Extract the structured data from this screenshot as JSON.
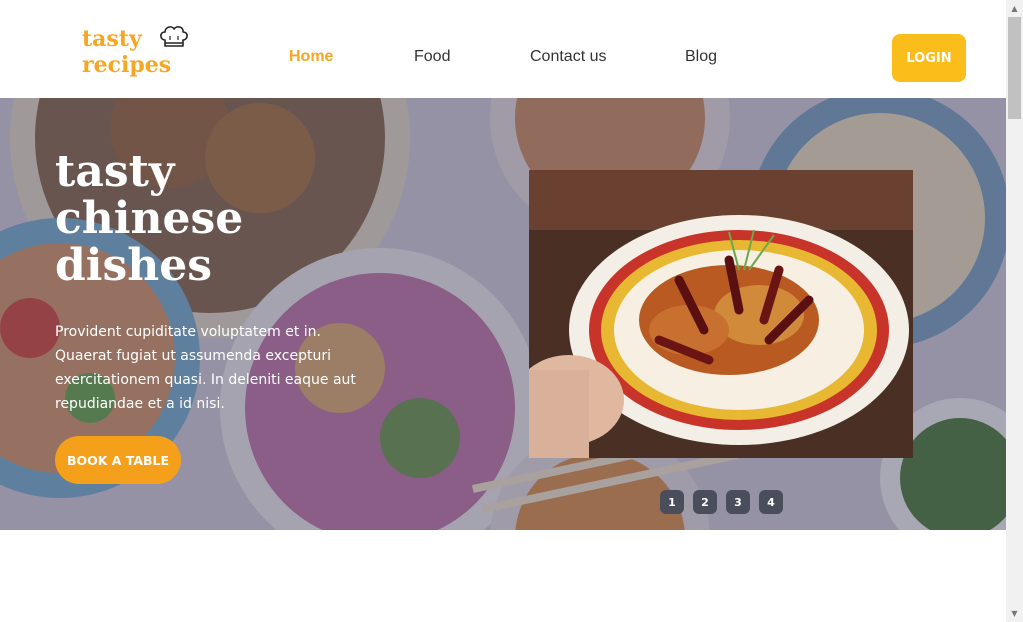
{
  "header": {
    "logo_line1": "tasty",
    "logo_line2": "recipes",
    "nav": [
      {
        "label": "Home",
        "active": true
      },
      {
        "label": "Food",
        "active": false
      },
      {
        "label": "Contact us",
        "active": false
      },
      {
        "label": "Blog",
        "active": false
      }
    ],
    "login_label": "LOGIN"
  },
  "hero": {
    "title_lines": [
      "tasty",
      "chinese",
      "dishes"
    ],
    "description": "Provident cupiditate voluptatem et in. Quaerat fugiat ut assumenda excepturi exercitationem quasi. In deleniti eaque aut repudiandae et a id nisi.",
    "cta_label": "BOOK A TABLE",
    "slides": [
      "1",
      "2",
      "3",
      "4"
    ]
  },
  "colors": {
    "accent": "#f5a623",
    "login_bg": "#fbbd1a",
    "cta_bg": "#f5a01a",
    "dot_bg": "#4a4d5c"
  },
  "icons": {
    "logo_hat": "chef-hat-icon",
    "scroll_up": "scroll-up-arrow-icon",
    "scroll_down": "scroll-down-arrow-icon"
  }
}
